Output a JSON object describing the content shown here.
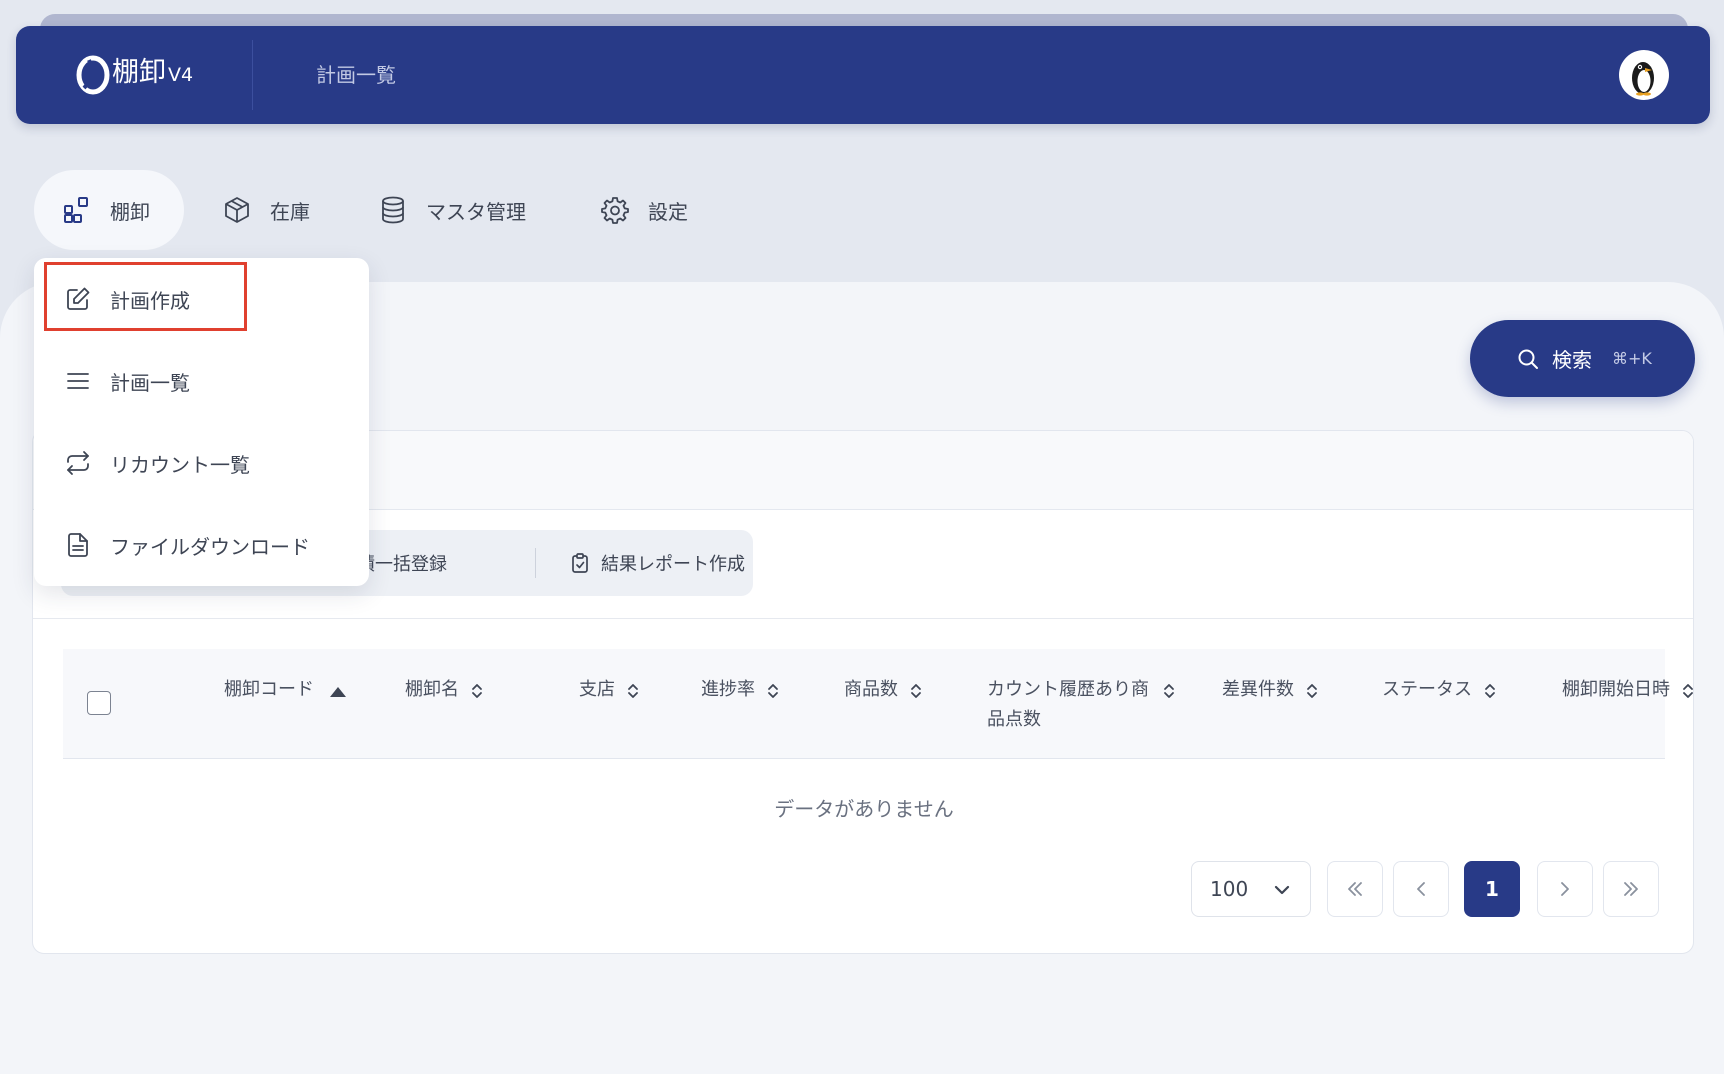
{
  "header": {
    "app_name": "棚卸",
    "version": "V4",
    "page_title": "計画一覧",
    "avatar": "penguin-avatar"
  },
  "nav": {
    "tabs": [
      {
        "label": "棚卸",
        "icon": "grid-icon",
        "active": true
      },
      {
        "label": "在庫",
        "icon": "box-icon",
        "active": false
      },
      {
        "label": "マスタ管理",
        "icon": "database-icon",
        "active": false
      },
      {
        "label": "設定",
        "icon": "gear-icon",
        "active": false
      }
    ]
  },
  "dropdown": {
    "items": [
      {
        "label": "計画作成",
        "icon": "edit-icon",
        "highlighted": true
      },
      {
        "label": "計画一覧",
        "icon": "list-icon"
      },
      {
        "label": "リカウント一覧",
        "icon": "repeat-icon"
      },
      {
        "label": "ファイルダウンロード",
        "icon": "file-icon"
      }
    ]
  },
  "search": {
    "label": "検索",
    "shortcut": "⌘+K"
  },
  "actions": {
    "bulk_register_partial": "積一括登録",
    "report_create": "結果レポート作成"
  },
  "table": {
    "columns": [
      {
        "label": "棚卸コード",
        "sort": "asc"
      },
      {
        "label": "棚卸名",
        "sort": "none"
      },
      {
        "label": "支店",
        "sort": "none"
      },
      {
        "label": "進捗率",
        "sort": "none"
      },
      {
        "label": "商品数",
        "sort": "none"
      },
      {
        "label": "カウント履歴あり商品点数",
        "sort": "none"
      },
      {
        "label": "差異件数",
        "sort": "none"
      },
      {
        "label": "ステータス",
        "sort": "none"
      },
      {
        "label": "棚卸開始日時",
        "sort": "none"
      }
    ],
    "empty_message": "データがありません"
  },
  "pagination": {
    "page_size": "100",
    "current_page": "1"
  },
  "colors": {
    "primary": "#283a87",
    "highlight": "#e0402f",
    "background": "#e4e8f0"
  }
}
